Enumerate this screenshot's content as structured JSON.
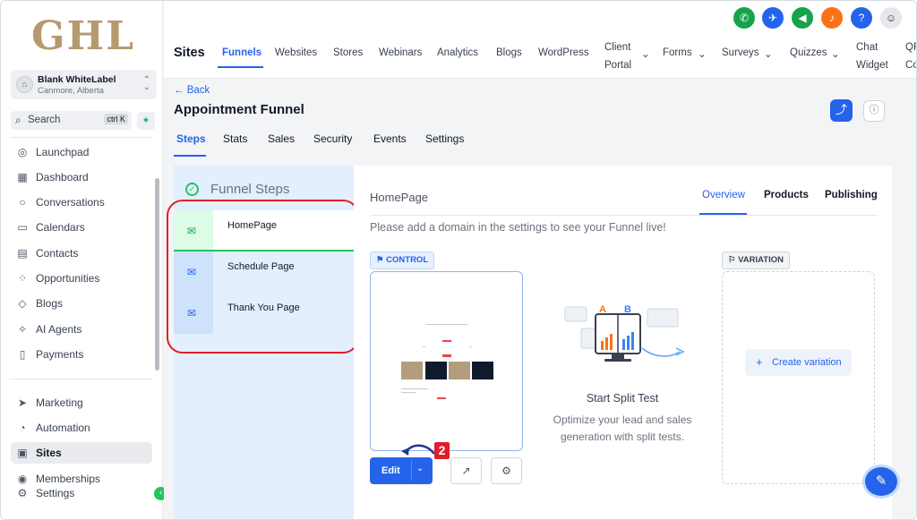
{
  "sidebar": {
    "logo": "GHL",
    "account": {
      "name": "Blank WhiteLabel",
      "location": "Canmore, Alberta"
    },
    "search": {
      "label": "Search",
      "shortcut": "ctrl K"
    },
    "items": [
      {
        "label": "Launchpad",
        "icon": "rocket-icon"
      },
      {
        "label": "Dashboard",
        "icon": "grid-icon"
      },
      {
        "label": "Conversations",
        "icon": "chat-bubble-icon"
      },
      {
        "label": "Calendars",
        "icon": "calendar-icon"
      },
      {
        "label": "Contacts",
        "icon": "contacts-icon"
      },
      {
        "label": "Opportunities",
        "icon": "opportunities-icon"
      },
      {
        "label": "Blogs",
        "icon": "cube-icon"
      },
      {
        "label": "AI Agents",
        "icon": "sparkle-icon"
      },
      {
        "label": "Payments",
        "icon": "receipt-icon"
      },
      {
        "label": "Marketing",
        "icon": "send-icon"
      },
      {
        "label": "Automation",
        "icon": "automation-icon"
      },
      {
        "label": "Sites",
        "icon": "sites-icon",
        "active": true
      },
      {
        "label": "Memberships",
        "icon": "memberships-icon"
      },
      {
        "label": "Settings",
        "icon": "gear-icon"
      }
    ]
  },
  "header": {
    "title": "Sites",
    "tabs": [
      "Funnels",
      "Websites",
      "Stores",
      "Webinars",
      "Analytics",
      "Blogs",
      "WordPress",
      "Client\nPortal",
      "Forms",
      "Surveys",
      "Quizzes",
      "Chat\nWidget",
      "QR\nCo"
    ],
    "active_tab": "Funnels",
    "icons": [
      {
        "name": "phone-icon",
        "color": "#16a34a"
      },
      {
        "name": "satellite-icon",
        "color": "#2563eb"
      },
      {
        "name": "megaphone-icon",
        "color": "#16a34a"
      },
      {
        "name": "bell-icon",
        "color": "#f97316"
      },
      {
        "name": "help-icon",
        "color": "#2563eb"
      }
    ]
  },
  "page": {
    "back_label": "← Back",
    "title": "Appointment Funnel",
    "tabs": [
      "Steps",
      "Stats",
      "Sales",
      "Security",
      "Events",
      "Settings"
    ],
    "active_tab": "Steps"
  },
  "funnel_steps": {
    "title": "Funnel Steps",
    "steps": [
      "HomePage",
      "Schedule Page",
      "Thank You Page"
    ],
    "active_step": "HomePage"
  },
  "step_detail": {
    "title": "HomePage",
    "tabs": [
      "Overview",
      "Products",
      "Publishing"
    ],
    "active_tab": "Overview",
    "notice": "Please add a domain in the settings to see your Funnel live!",
    "control_tag": "CONTROL",
    "variation_tag": "VARIATION",
    "edit_label": "Edit",
    "annotation_number": "2",
    "split_test": {
      "title": "Start Split Test",
      "description": "Optimize your lead and sales generation with split tests."
    },
    "create_variation_label": "Create variation"
  },
  "colors": {
    "accent": "#2563eb",
    "success": "#22c55e",
    "annotation_red": "#e11d2b",
    "logo_gold": "#b59a6f"
  }
}
